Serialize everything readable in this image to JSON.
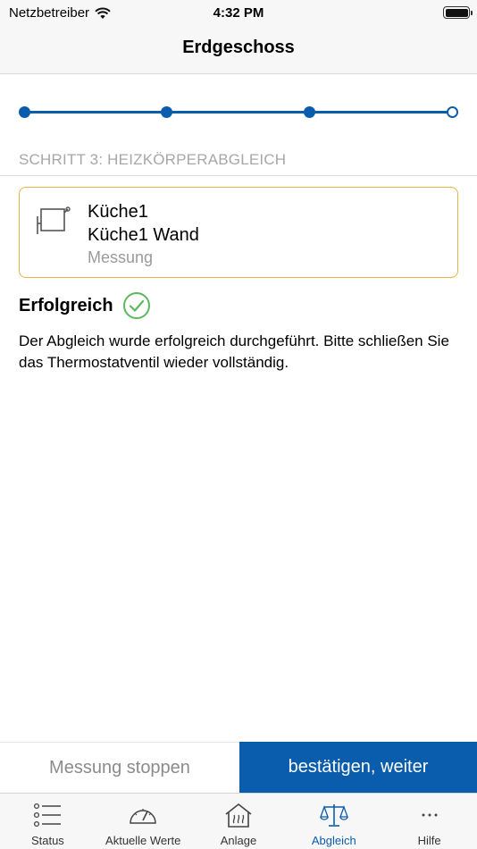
{
  "status_bar": {
    "carrier": "Netzbetreiber",
    "time": "4:32 PM"
  },
  "header": {
    "title": "Erdgeschoss"
  },
  "progress": {
    "total_steps": 4,
    "completed_steps": 3
  },
  "step": {
    "label": "SCHRITT 3: HEIZKÖRPERABGLEICH"
  },
  "radiator_card": {
    "icon": "radiator-icon",
    "room": "Küche1",
    "name": "Küche1 Wand",
    "mode": "Messung",
    "border_color": "#e3b544"
  },
  "result": {
    "title": "Erfolgreich",
    "icon": "check-circle-icon",
    "icon_color": "#5cb85c",
    "message": "Der Abgleich wurde erfolgreich durchgeführt. Bitte schließen Sie das Thermostatventil wieder vollständig."
  },
  "actions": {
    "stop_label": "Messung stoppen",
    "confirm_label": "bestätigen, weiter",
    "confirm_color": "#0a5cac"
  },
  "tabs": [
    {
      "label": "Status",
      "icon": "list-icon",
      "active": false
    },
    {
      "label": "Aktuelle Werte",
      "icon": "gauge-icon",
      "active": false
    },
    {
      "label": "Anlage",
      "icon": "house-heat-icon",
      "active": false
    },
    {
      "label": "Abgleich",
      "icon": "balance-scale-icon",
      "active": true
    },
    {
      "label": "Hilfe",
      "icon": "more-icon",
      "active": false
    }
  ],
  "accent_color": "#0a5cac"
}
